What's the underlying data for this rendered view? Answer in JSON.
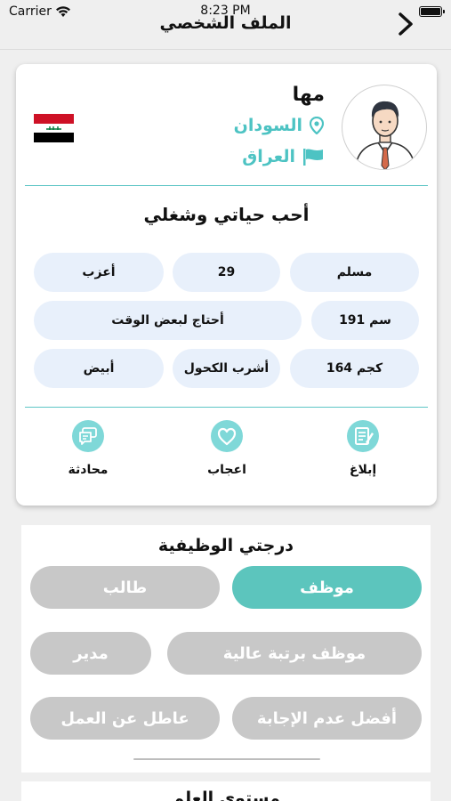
{
  "status_bar": {
    "carrier": "Carrier",
    "time": "8:23 PM"
  },
  "nav": {
    "title": "الملف الشخصي"
  },
  "profile": {
    "name": "مها",
    "city": "السودان",
    "country": "العراق",
    "bio": "أحب حياتي وشغلي",
    "attributes": {
      "religion": "مسلم",
      "age": "29",
      "marital": "أعزب",
      "height": "191 سم",
      "need": "أحتاج لبعض الوقت",
      "weight": "164 كجم",
      "alcohol": "أشرب الكحول",
      "skin": "أبيض"
    },
    "actions": {
      "report": "إبلاغ",
      "like": "اعجاب",
      "chat": "محادثة"
    }
  },
  "job": {
    "title": "درجتي الوظيفية",
    "options": {
      "employee": "موظف",
      "student": "طالب",
      "senior": "موظف برتبة عالية",
      "manager": "مدير",
      "no_answer": "أفضل عدم الإجابة",
      "unemployed": "عاطل عن العمل"
    },
    "selected": "موظف"
  },
  "education": {
    "title": "مستوى العلم"
  },
  "colors": {
    "accent": "#5cc5bd",
    "teal_text": "#4dc3c3",
    "chip_bg": "#e8f0fb",
    "unselected": "#c8c8c8"
  },
  "icons": {
    "back": "chevron-right-icon",
    "city": "location-pin-icon",
    "country": "flag-icon",
    "report": "report-icon",
    "like": "heart-icon",
    "chat": "chat-icon"
  }
}
